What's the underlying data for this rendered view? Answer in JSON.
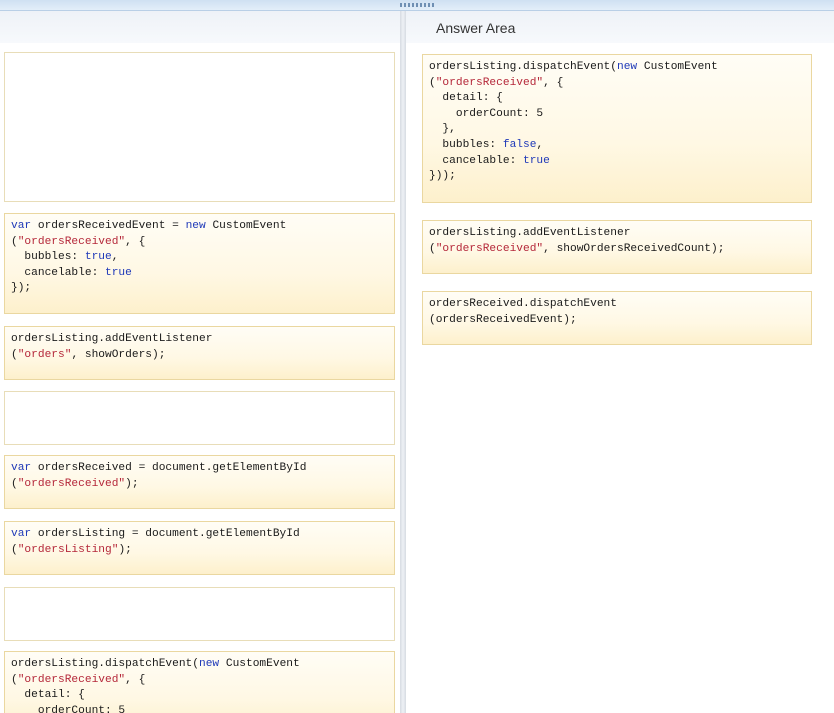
{
  "answer_area": {
    "title": "Answer Area"
  },
  "colors": {
    "keyword": "#1f39b8",
    "string": "#b5283a",
    "text": "#1a1a1a",
    "block_bg": "#fff8e4",
    "block_border": "#ead7a0"
  },
  "source_blocks": [
    {
      "id": "create-event",
      "lines": [
        [
          {
            "t": "kw",
            "v": "var"
          },
          {
            "t": "p",
            "v": " ordersReceivedEvent = "
          },
          {
            "t": "kw",
            "v": "new"
          },
          {
            "t": "p",
            "v": " CustomEvent"
          }
        ],
        [
          {
            "t": "p",
            "v": "("
          },
          {
            "t": "str",
            "v": "\"ordersReceived\""
          },
          {
            "t": "p",
            "v": ", {"
          }
        ],
        [
          {
            "t": "p",
            "v": "  bubbles: "
          },
          {
            "t": "kw",
            "v": "true"
          },
          {
            "t": "p",
            "v": ","
          }
        ],
        [
          {
            "t": "p",
            "v": "  cancelable: "
          },
          {
            "t": "kw",
            "v": "true"
          }
        ],
        [
          {
            "t": "p",
            "v": "});"
          }
        ]
      ]
    },
    {
      "id": "listen-orders",
      "lines": [
        [
          {
            "t": "p",
            "v": "ordersListing.addEventListener"
          }
        ],
        [
          {
            "t": "p",
            "v": "("
          },
          {
            "t": "str",
            "v": "\"orders\""
          },
          {
            "t": "p",
            "v": ", showOrders);"
          }
        ]
      ]
    },
    {
      "id": "get-orders-received",
      "lines": [
        [
          {
            "t": "kw",
            "v": "var"
          },
          {
            "t": "p",
            "v": " ordersReceived = document.getElementById"
          }
        ],
        [
          {
            "t": "p",
            "v": "("
          },
          {
            "t": "str",
            "v": "\"ordersReceived\""
          },
          {
            "t": "p",
            "v": ");"
          }
        ]
      ]
    },
    {
      "id": "get-orders-listing",
      "lines": [
        [
          {
            "t": "kw",
            "v": "var"
          },
          {
            "t": "p",
            "v": " ordersListing = document.getElementById"
          }
        ],
        [
          {
            "t": "p",
            "v": "("
          },
          {
            "t": "str",
            "v": "\"ordersListing\""
          },
          {
            "t": "p",
            "v": ");"
          }
        ]
      ]
    },
    {
      "id": "dispatch-new-event-partial",
      "lines": [
        [
          {
            "t": "p",
            "v": "ordersListing.dispatchEvent("
          },
          {
            "t": "kw",
            "v": "new"
          },
          {
            "t": "p",
            "v": " CustomEvent"
          }
        ],
        [
          {
            "t": "p",
            "v": "("
          },
          {
            "t": "str",
            "v": "\"ordersReceived\""
          },
          {
            "t": "p",
            "v": ", {"
          }
        ],
        [
          {
            "t": "p",
            "v": "  detail: {"
          }
        ],
        [
          {
            "t": "p",
            "v": "    orderCount: 5"
          }
        ]
      ]
    }
  ],
  "answer_blocks": [
    {
      "id": "dispatch-new-event",
      "lines": [
        [
          {
            "t": "p",
            "v": "ordersListing.dispatchEvent("
          },
          {
            "t": "kw",
            "v": "new"
          },
          {
            "t": "p",
            "v": " CustomEvent"
          }
        ],
        [
          {
            "t": "p",
            "v": "("
          },
          {
            "t": "str",
            "v": "\"ordersReceived\""
          },
          {
            "t": "p",
            "v": ", {"
          }
        ],
        [
          {
            "t": "p",
            "v": "  detail: {"
          }
        ],
        [
          {
            "t": "p",
            "v": "    orderCount: 5"
          }
        ],
        [
          {
            "t": "p",
            "v": "  },"
          }
        ],
        [
          {
            "t": "p",
            "v": "  bubbles: "
          },
          {
            "t": "kw",
            "v": "false"
          },
          {
            "t": "p",
            "v": ","
          }
        ],
        [
          {
            "t": "p",
            "v": "  cancelable: "
          },
          {
            "t": "kw",
            "v": "true"
          }
        ],
        [
          {
            "t": "p",
            "v": "}));"
          }
        ]
      ]
    },
    {
      "id": "listen-orders-received",
      "lines": [
        [
          {
            "t": "p",
            "v": "ordersListing.addEventListener"
          }
        ],
        [
          {
            "t": "p",
            "v": "("
          },
          {
            "t": "str",
            "v": "\"ordersReceived\""
          },
          {
            "t": "p",
            "v": ", showOrdersReceivedCount);"
          }
        ]
      ]
    },
    {
      "id": "dispatch-event-var",
      "lines": [
        [
          {
            "t": "p",
            "v": "ordersReceived.dispatchEvent"
          }
        ],
        [
          {
            "t": "p",
            "v": "(ordersReceivedEvent);"
          }
        ]
      ]
    }
  ]
}
